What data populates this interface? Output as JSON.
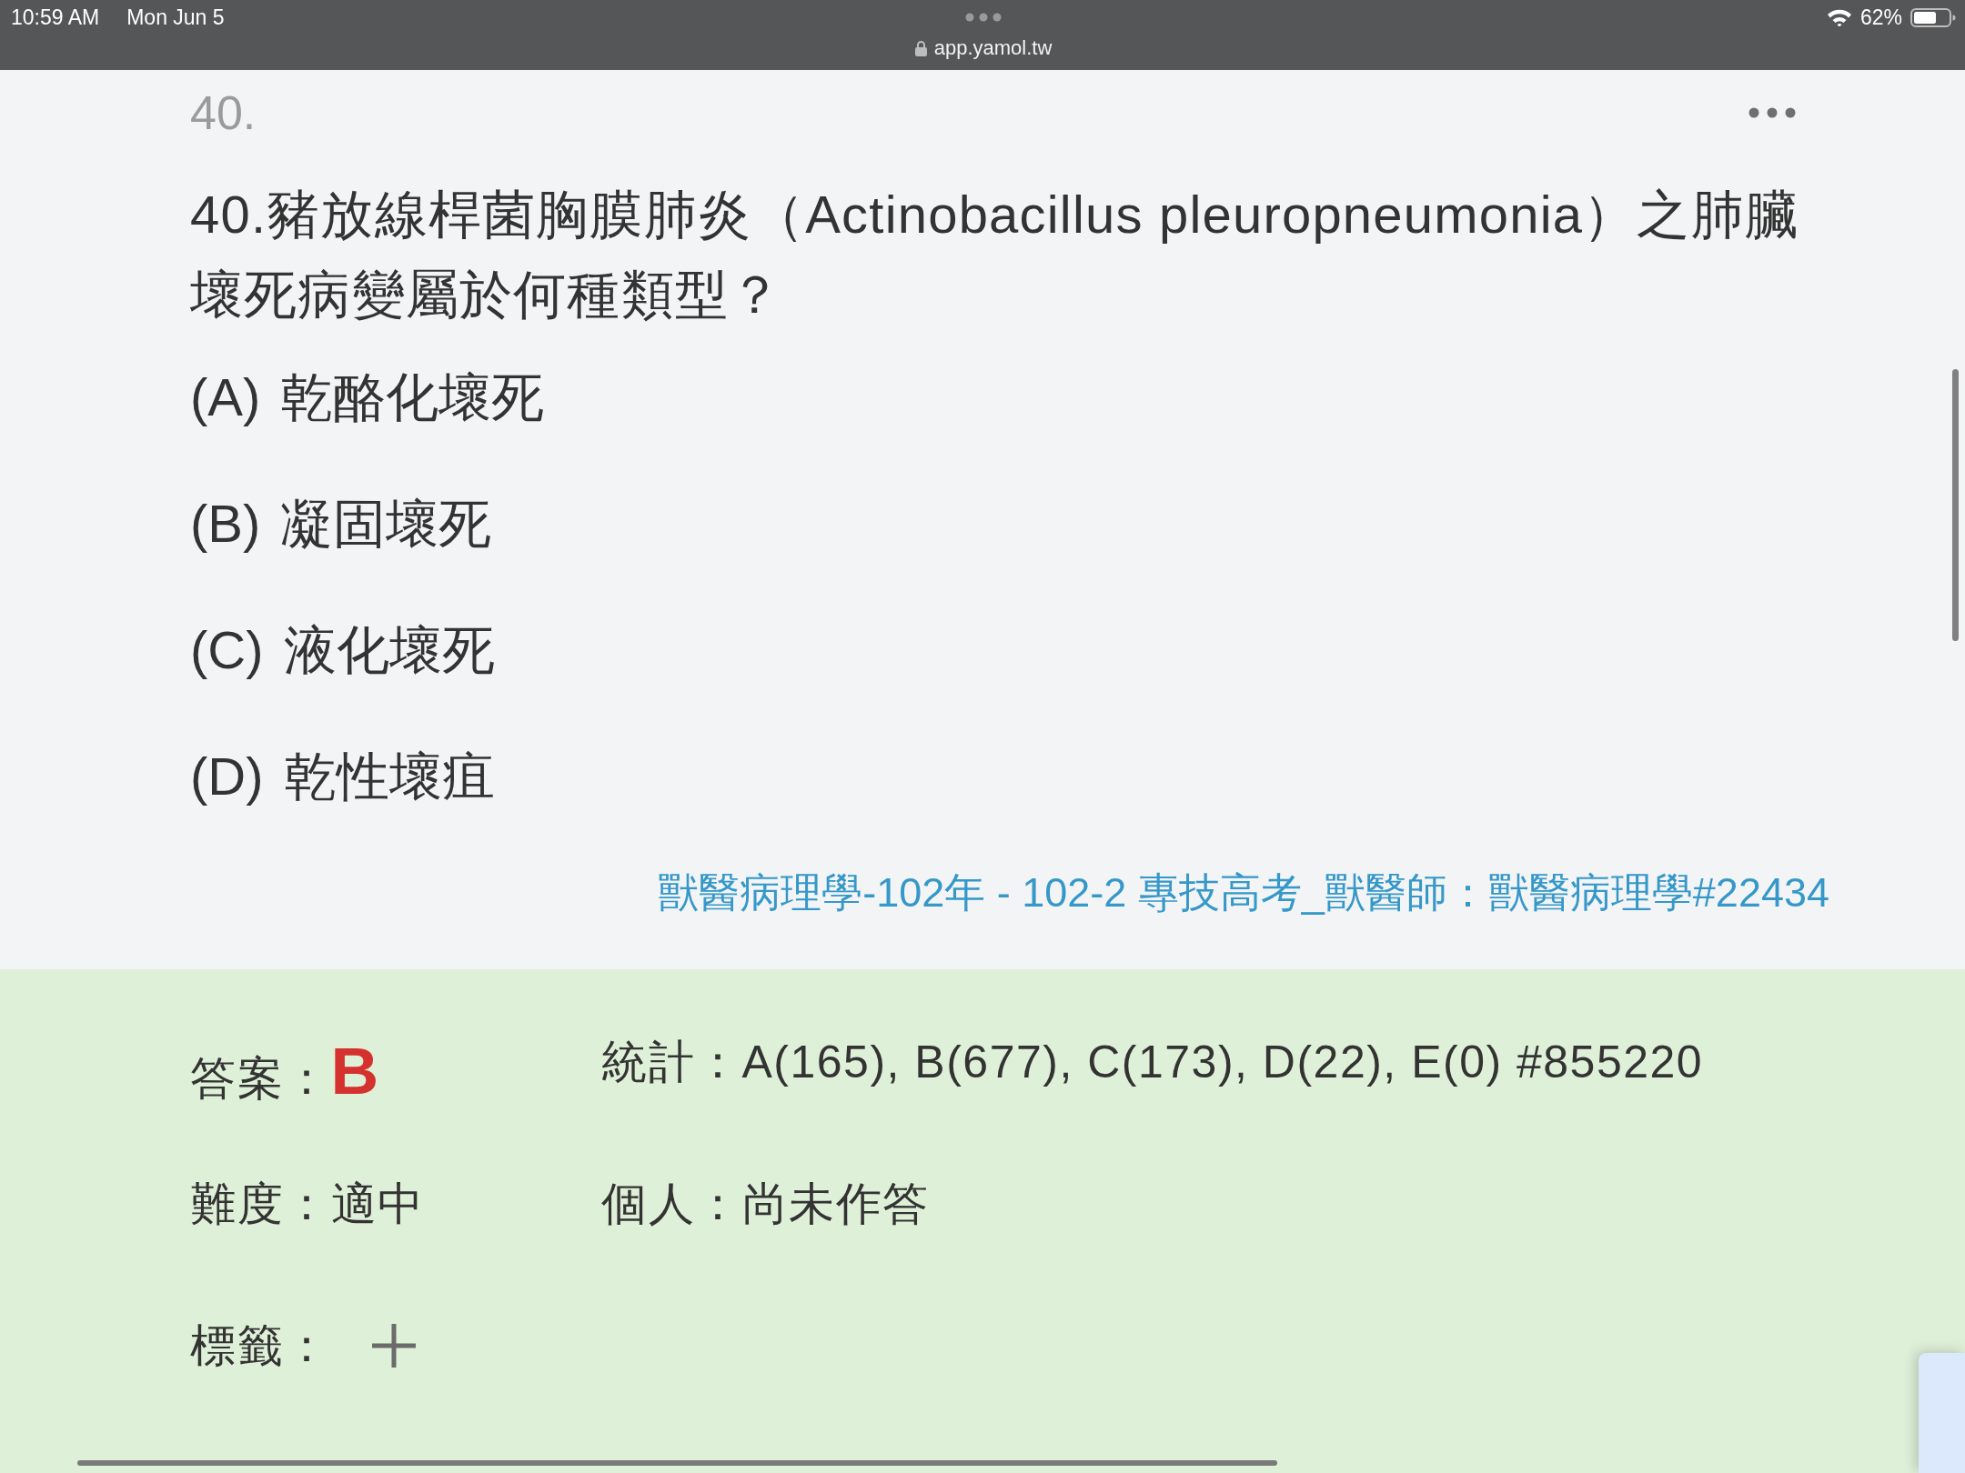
{
  "status_bar": {
    "time": "10:59 AM",
    "date": "Mon Jun 5",
    "url": "app.yamol.tw",
    "battery": "62%"
  },
  "question": {
    "number": "40.",
    "text": "40.豬放線桿菌胸膜肺炎（Actinobacillus pleuropneumonia）之肺臟壞死病變屬於何種類型？",
    "options": [
      {
        "label": "(A)",
        "text": "乾酪化壞死"
      },
      {
        "label": "(B)",
        "text": "凝固壞死"
      },
      {
        "label": "(C)",
        "text": "液化壞死"
      },
      {
        "label": "(D)",
        "text": "乾性壞疽"
      }
    ],
    "source": "獸醫病理學-102年 - 102-2 專技高考_獸醫師：獸醫病理學#22434"
  },
  "answer_panel": {
    "answer_label": "答案：",
    "answer": "B",
    "statistics": "統計：A(165), B(677), C(173), D(22), E(0) #855220",
    "difficulty": "難度：適中",
    "personal": "個人：尚未作答",
    "tags_label": "標籤："
  }
}
